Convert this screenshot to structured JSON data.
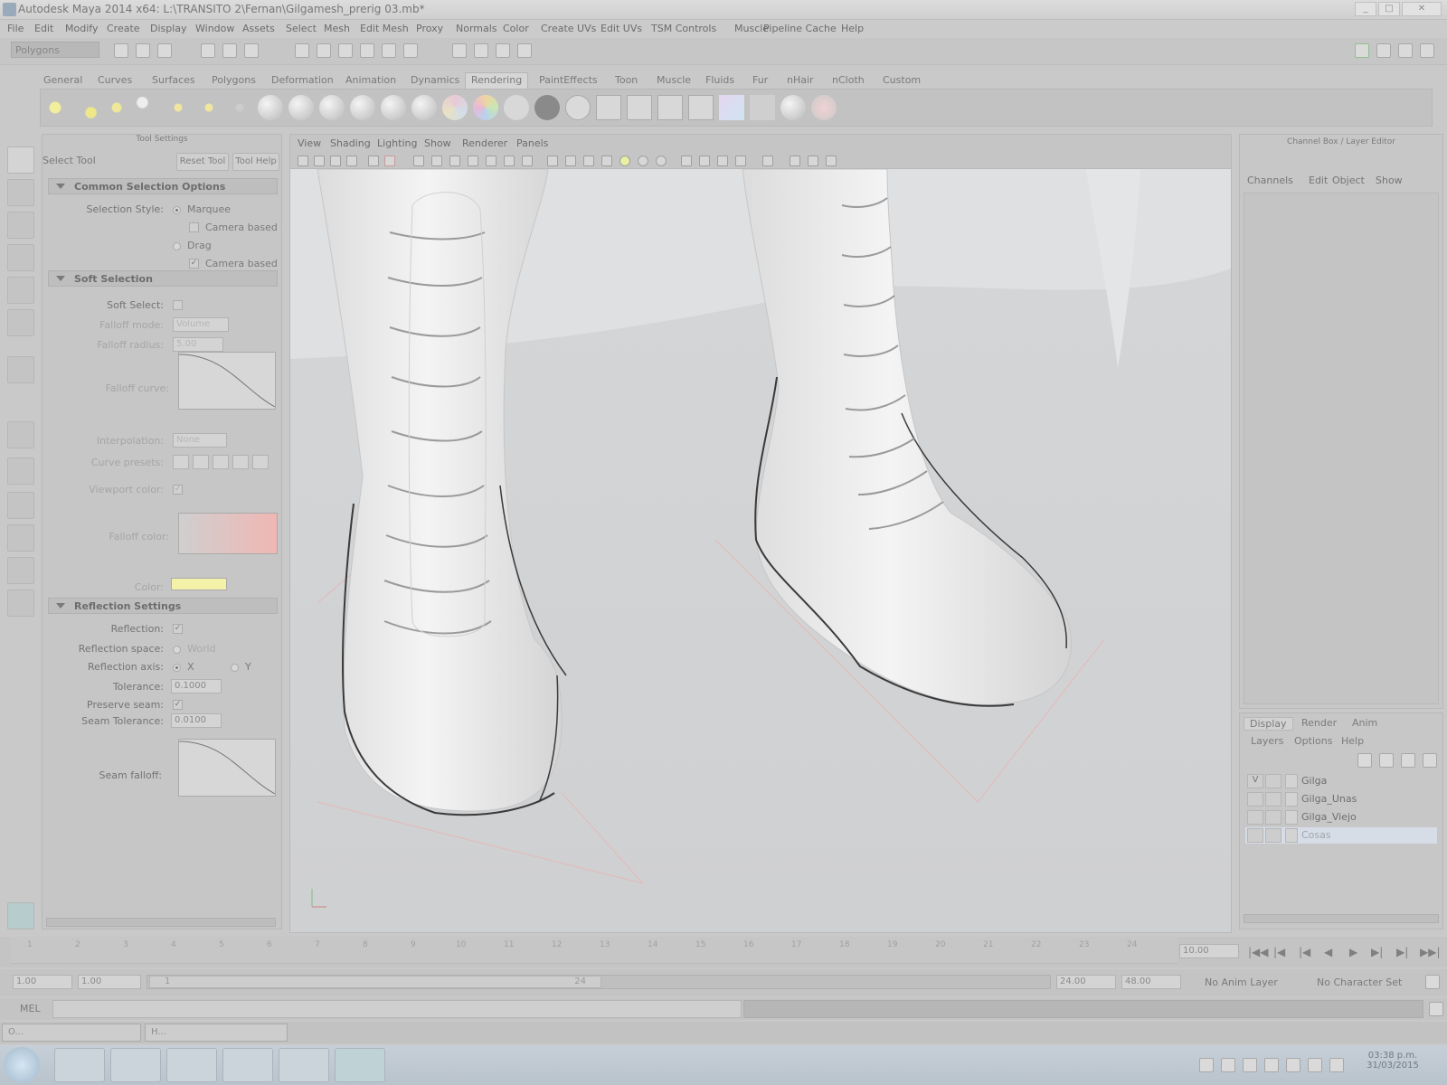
{
  "window": {
    "title": "Autodesk Maya 2014 x64: L:\\TRANSITO 2\\Fernan\\Gilgamesh_prerig 03.mb*"
  },
  "menubar": [
    "File",
    "Edit",
    "Modify",
    "Create",
    "Display",
    "Window",
    "Assets",
    "Select",
    "Mesh",
    "Edit Mesh",
    "Proxy",
    "Normals",
    "Color",
    "Create UVs",
    "Edit UVs",
    "TSM Controls",
    "Muscle",
    "Pipeline Cache",
    "Help"
  ],
  "statusline": {
    "mode": "Polygons"
  },
  "shelf": {
    "tabs": [
      "General",
      "Curves",
      "Surfaces",
      "Polygons",
      "Deformation",
      "Animation",
      "Dynamics",
      "Rendering",
      "PaintEffects",
      "Toon",
      "Muscle",
      "Fluids",
      "Fur",
      "nHair",
      "nCloth",
      "Custom"
    ],
    "active_tab": "Rendering"
  },
  "tool_settings": {
    "header": "Tool Settings",
    "tool_name": "Select Tool",
    "reset_button": "Reset Tool",
    "help_button": "Tool Help",
    "common": {
      "title": "Common Selection Options",
      "style_label": "Selection Style:",
      "marquee": "Marquee",
      "camera_based_sel": "Camera based se",
      "drag": "Drag",
      "camera_based_paint": "Camera based pa"
    },
    "soft": {
      "title": "Soft Selection",
      "soft_select": "Soft Select:",
      "falloff_mode": "Falloff mode:",
      "falloff_mode_value": "Volume",
      "falloff_radius": "Falloff radius:",
      "falloff_radius_value": "5.00",
      "falloff_curve": "Falloff curve:",
      "interpolation": "Interpolation:",
      "interpolation_value": "None",
      "curve_presets": "Curve presets:",
      "viewport_color": "Viewport color:",
      "falloff_color": "Falloff color:",
      "color": "Color:"
    },
    "reflection": {
      "title": "Reflection Settings",
      "reflection": "Reflection:",
      "space": "Reflection space:",
      "space_value": "World",
      "axis": "Reflection axis:",
      "axis_x": "X",
      "axis_y": "Y",
      "tolerance": "Tolerance:",
      "tolerance_value": "0.1000",
      "preserve": "Preserve seam:",
      "seam_tol": "Seam Tolerance:",
      "seam_tol_value": "0.0100",
      "seam_falloff": "Seam falloff:"
    }
  },
  "viewport": {
    "menus": [
      "View",
      "Shading",
      "Lighting",
      "Show",
      "Renderer",
      "Panels"
    ]
  },
  "channelbox": {
    "title": "Channel Box / Layer Editor",
    "menus": [
      "Channels",
      "Edit",
      "Object",
      "Show"
    ]
  },
  "layers": {
    "tabs": [
      "Display",
      "Render",
      "Anim"
    ],
    "menus": [
      "Layers",
      "Options",
      "Help"
    ],
    "items": [
      {
        "v": "V",
        "name": "Gilga"
      },
      {
        "v": "",
        "name": "Gilga_Unas"
      },
      {
        "v": "",
        "name": "Gilga_Viejo"
      },
      {
        "v": "",
        "name": "Cosas"
      }
    ]
  },
  "timeline": {
    "ticks": [
      "1",
      "2",
      "3",
      "4",
      "5",
      "6",
      "7",
      "8",
      "9",
      "10",
      "11",
      "12",
      "13",
      "14",
      "15",
      "16",
      "17",
      "18",
      "19",
      "20",
      "21",
      "22",
      "23",
      "24"
    ],
    "current_frame": "10.00"
  },
  "range": {
    "start": "1.00",
    "start2": "1.00",
    "slider_start": "1",
    "slider_end": "24",
    "end": "24.00",
    "end2": "48.00",
    "anim_layer": "No Anim Layer",
    "char_set": "No Character Set"
  },
  "command": {
    "label": "MEL"
  },
  "minimized": [
    {
      "label": "O..."
    },
    {
      "label": "H..."
    }
  ],
  "clock": {
    "time": "03:38 p.m.",
    "date": "31/03/2015"
  },
  "colors": {
    "viewport_bg": "#d3d5d7",
    "selection": "#d7dde6",
    "color_swatch": "#f4f2a8",
    "falloff_gradient_end": "#f0b7b3"
  }
}
